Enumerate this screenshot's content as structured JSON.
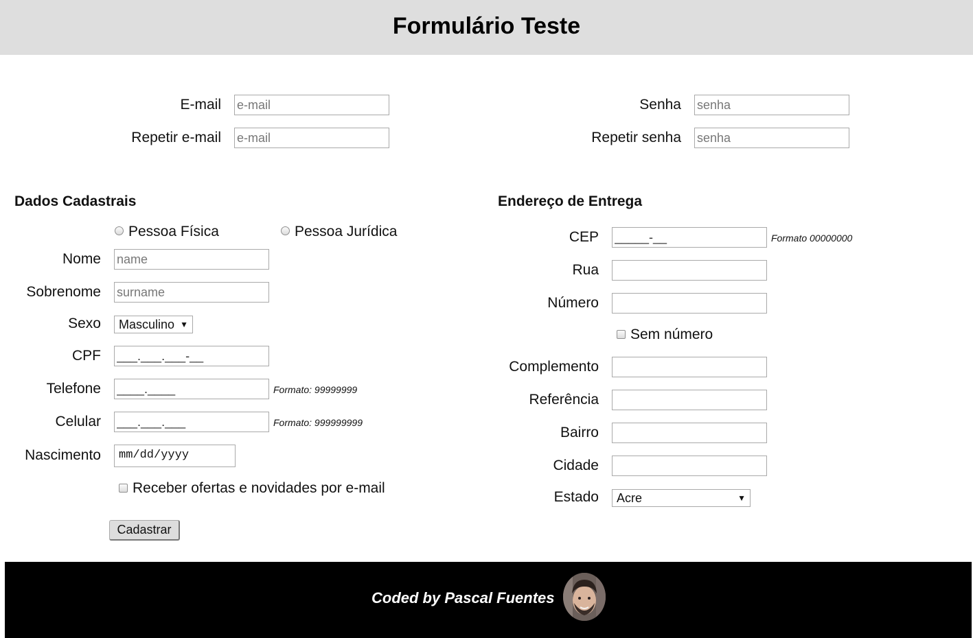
{
  "page": {
    "title": "Formulário Teste"
  },
  "account": {
    "email_label": "E-mail",
    "email_placeholder": "e-mail",
    "repeat_email_label": "Repetir e-mail",
    "repeat_email_placeholder": "e-mail",
    "password_label": "Senha",
    "password_placeholder": "senha",
    "repeat_password_label": "Repetir senha",
    "repeat_password_placeholder": "senha"
  },
  "dados": {
    "title": "Dados Cadastrais",
    "person_types": [
      "Pessoa Física",
      "Pessoa Jurídica"
    ],
    "name_label": "Nome",
    "name_placeholder": "name",
    "surname_label": "Sobrenome",
    "surname_placeholder": "surname",
    "sex_label": "Sexo",
    "sex_value": "Masculino",
    "cpf_label": "CPF",
    "cpf_mask": "___.___.___-__",
    "phone_label": "Telefone",
    "phone_mask": "____.____",
    "phone_hint": "Formato: 99999999",
    "mobile_label": "Celular",
    "mobile_mask": "___.___.___",
    "mobile_hint": "Formato: 999999999",
    "birth_label": "Nascimento",
    "birth_value": "mm/dd/yyyy",
    "newsletter_label": "Receber ofertas e novidades por e-mail",
    "submit_label": "Cadastrar"
  },
  "endereco": {
    "title": "Endereço de Entrega",
    "cep_label": "CEP",
    "cep_mask": "_____-__",
    "cep_hint": "Formato 00000000",
    "street_label": "Rua",
    "number_label": "Número",
    "no_number_label": "Sem número",
    "complement_label": "Complemento",
    "reference_label": "Referência",
    "district_label": "Bairro",
    "city_label": "Cidade",
    "state_label": "Estado",
    "state_value": "Acre"
  },
  "footer": {
    "credit": "Coded by Pascal Fuentes"
  },
  "icons": {
    "dropdown": "triangle-down-icon"
  }
}
